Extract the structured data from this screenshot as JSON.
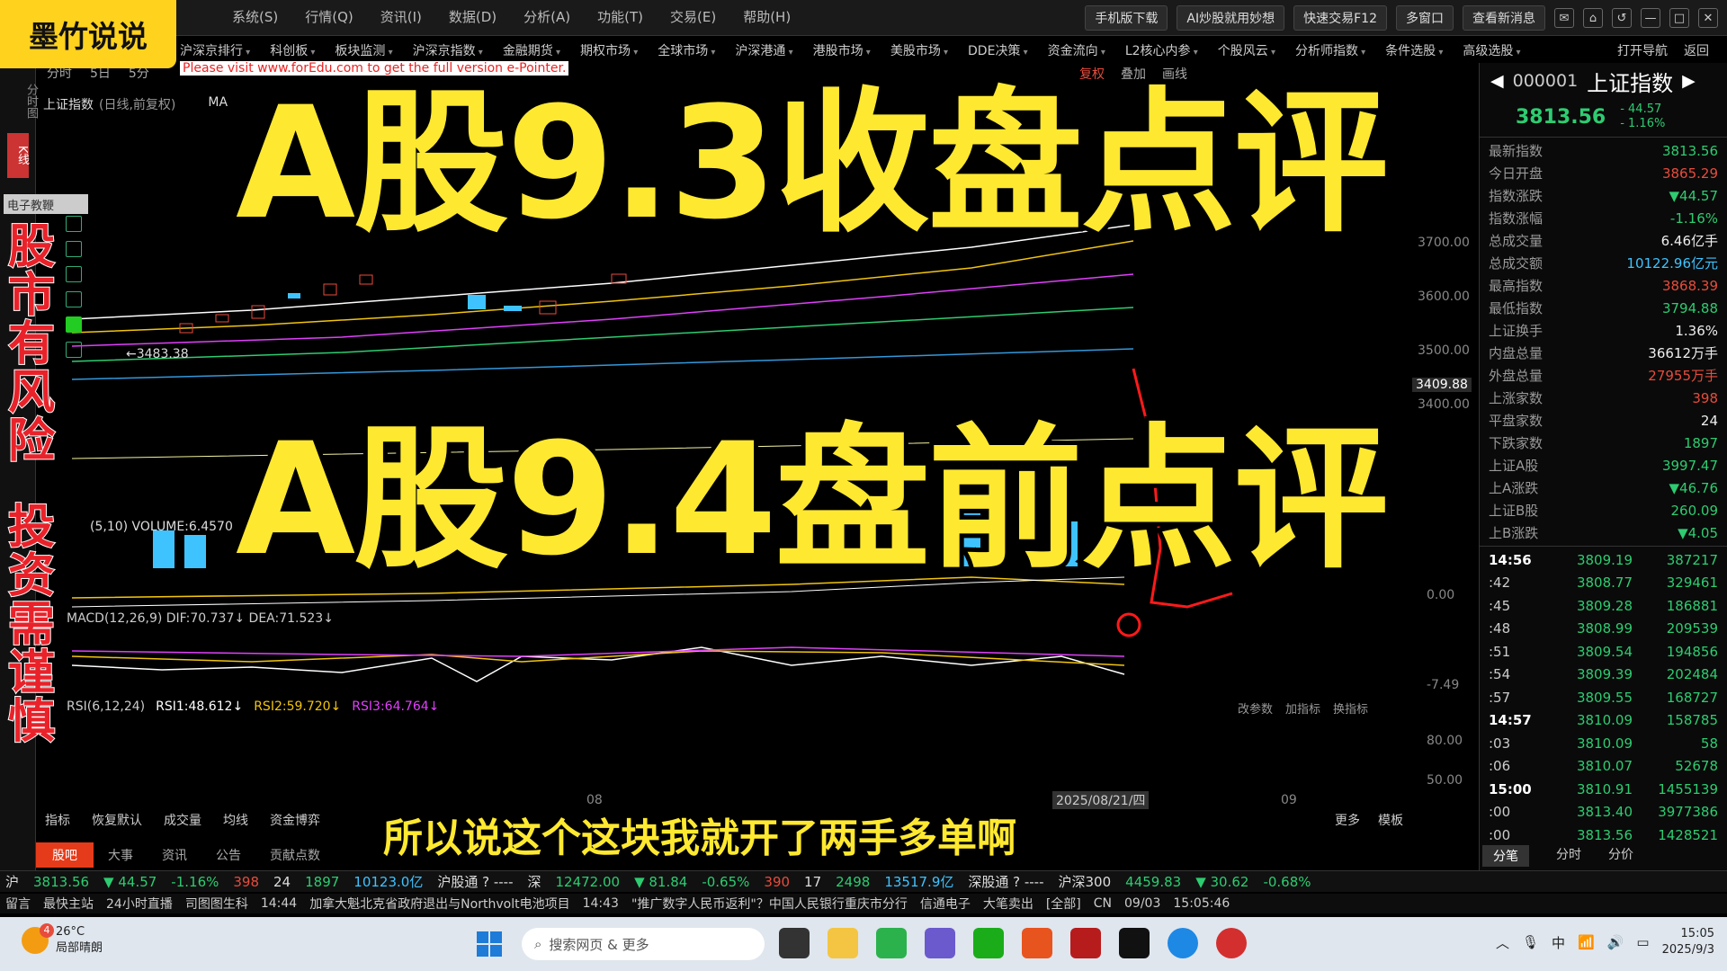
{
  "channel": {
    "name": "墨竹说说"
  },
  "menu": [
    "系统(S)",
    "行情(Q)",
    "资讯(I)",
    "数据(D)",
    "分析(A)",
    "功能(T)",
    "交易(E)",
    "帮助(H)"
  ],
  "top_buttons": {
    "mobile": "手机版下载",
    "ai": "AI炒股就用妙想",
    "quick_trade": "快速交易F12",
    "multi_window": "多窗口",
    "news": "查看新消息"
  },
  "nav": [
    "沪深京排行",
    "科创板",
    "板块监测",
    "沪深京指数",
    "金融期货",
    "期权市场",
    "全球市场",
    "沪深港通",
    "港股市场",
    "美股市场",
    "DDE决策",
    "资金流向",
    "L2核心内参",
    "个股风云",
    "分析师指数",
    "条件选股",
    "高级选股"
  ],
  "nav_right": {
    "open_nav": "打开导航",
    "back": "返回"
  },
  "chart": {
    "toolbar": [
      "分时",
      "5日",
      "5分"
    ],
    "right_tools": [
      "复权",
      "叠加",
      "画线"
    ],
    "title": "上证指数",
    "subtitle": "(日线,前复权)",
    "ma_label": "MA",
    "note": "Please visit www.forEdu.com to get the full version e-Pointer.",
    "low_marker": "←3483.38",
    "price_tag": "3409.88",
    "y_labels": [
      "3700.00",
      "3600.00",
      "3500.00",
      "3400.00"
    ],
    "volume_label": "(5,10)  VOLUME:6.4570",
    "macd_label": "MACD(12,26,9)  DIF:70.737↓  DEA:71.523↓",
    "rsi_label": "RSI(6,12,24)",
    "rsi1": "RSI1:48.612↓",
    "rsi2": "RSI2:59.720↓",
    "rsi3": "RSI3:64.764↓",
    "macd_values": [
      "0.00",
      "-7.49"
    ],
    "rsi_values": [
      "80.00",
      "50.00"
    ],
    "date_label": "2025/08/21/四",
    "x_labels": [
      "08",
      "09"
    ],
    "ind_controls": [
      "改参数",
      "加指标",
      "换指标"
    ],
    "sidebar_tag": "电子教鞭"
  },
  "left_strip": {
    "items": [
      "分时图",
      "K线"
    ]
  },
  "headline": {
    "line1": "A股9.3收盘点评",
    "line2": "A股9.4盘前点评"
  },
  "side_warning": {
    "top": [
      "股",
      "市",
      "有",
      "风",
      "险"
    ],
    "bottom": [
      "投",
      "资",
      "需",
      "谨",
      "慎"
    ]
  },
  "subtitle": "所以说这个这块我就开了两手多单啊",
  "quote": {
    "code": "000001",
    "name": "上证指数",
    "price": "3813.56",
    "change": "- 44.57",
    "change_pct": "- 1.16%",
    "stats": [
      {
        "k": "最新指数",
        "v": "3813.56",
        "c": "green"
      },
      {
        "k": "今日开盘",
        "v": "3865.29",
        "c": "red"
      },
      {
        "k": "指数涨跌",
        "v": "▼44.57",
        "c": "green"
      },
      {
        "k": "指数涨幅",
        "v": "-1.16%",
        "c": "green"
      },
      {
        "k": "总成交量",
        "v": "6.46亿手",
        "c": ""
      },
      {
        "k": "总成交额",
        "v": "10122.96亿元",
        "c": "cyan"
      },
      {
        "k": "最高指数",
        "v": "3868.39",
        "c": "red"
      },
      {
        "k": "最低指数",
        "v": "3794.88",
        "c": "green"
      },
      {
        "k": "上证换手",
        "v": "1.36%",
        "c": ""
      },
      {
        "k": "内盘总量",
        "v": "36612万手",
        "c": ""
      },
      {
        "k": "外盘总量",
        "v": "27955万手",
        "c": "red"
      },
      {
        "k": "上涨家数",
        "v": "398",
        "c": "red"
      },
      {
        "k": "平盘家数",
        "v": "24",
        "c": ""
      },
      {
        "k": "下跌家数",
        "v": "1897",
        "c": "green"
      },
      {
        "k": "上证A股",
        "v": "3997.47",
        "c": "green"
      },
      {
        "k": "上A涨跌",
        "v": "▼46.76",
        "c": "green"
      },
      {
        "k": "上证B股",
        "v": "260.09",
        "c": "green"
      },
      {
        "k": "上B涨跌",
        "v": "▼4.05",
        "c": "green"
      }
    ],
    "ticks": [
      {
        "t": "14:56",
        "p": "3809.19",
        "v": "387217",
        "w": true
      },
      {
        "t": ":42",
        "p": "3808.77",
        "v": "329461",
        "w": false
      },
      {
        "t": ":45",
        "p": "3809.28",
        "v": "186881",
        "w": false
      },
      {
        "t": ":48",
        "p": "3808.99",
        "v": "209539",
        "w": false
      },
      {
        "t": ":51",
        "p": "3809.54",
        "v": "194856",
        "w": false
      },
      {
        "t": ":54",
        "p": "3809.39",
        "v": "202484",
        "w": false
      },
      {
        "t": ":57",
        "p": "3809.55",
        "v": "168727",
        "w": false
      },
      {
        "t": "14:57",
        "p": "3810.09",
        "v": "158785",
        "w": true
      },
      {
        "t": ":03",
        "p": "3810.09",
        "v": "58",
        "w": false
      },
      {
        "t": ":06",
        "p": "3810.07",
        "v": "52678",
        "w": false
      },
      {
        "t": "15:00",
        "p": "3810.91",
        "v": "1455139",
        "w": true
      },
      {
        "t": ":00",
        "p": "3813.40",
        "v": "3977386",
        "w": false
      },
      {
        "t": ":00",
        "p": "3813.56",
        "v": "1428521",
        "w": false
      }
    ],
    "tabs": [
      "分笔",
      "分时",
      "分价"
    ]
  },
  "bottom_tabs": [
    "股吧",
    "大事",
    "资讯",
    "公告",
    "贡献点数"
  ],
  "ind_tabs": [
    "指标",
    "恢复默认",
    "成交量",
    "均线",
    "资金博弈"
  ],
  "ind_tabs_right": [
    "更多",
    "模板"
  ],
  "status": {
    "sh_label": "沪",
    "sh_price": "3813.56",
    "sh_chg": "▼ 44.57",
    "sh_pct": "-1.16%",
    "sh_up": "398",
    "sh_flat": "24",
    "sh_down": "1897",
    "sh_amount": "10123.0亿",
    "hgt": "沪股通 ?  ----",
    "sz_label": "深",
    "sz_price": "12472.00",
    "sz_chg": "▼ 81.84",
    "sz_pct": "-0.65%",
    "sz_up": "390",
    "sz_flat": "17",
    "sz_down": "2498",
    "sz_amount": "13517.9亿",
    "sgt": "深股通 ?  ----",
    "hs300_label": "沪深300",
    "hs300_price": "4459.83",
    "hs300_chg": "▼ 30.62",
    "hs300_pct": "-0.68%"
  },
  "news": {
    "items": [
      "留言",
      "最快主站",
      "24小时直播",
      "司图图生科",
      "14:44",
      "加拿大魁北克省政府退出与Northvolt电池项目",
      "14:43",
      "\"推广数字人民币返利\"？中国人民银行重庆市分行",
      "信通电子",
      "大笔卖出",
      "[全部]",
      "CN",
      "09/03",
      "15:05:46"
    ]
  },
  "taskbar": {
    "temp": "26°C",
    "weather": "局部晴朗",
    "search_placeholder": "搜索网页 & 更多",
    "ime": "中",
    "time": "15:05",
    "date": "2025/9/3"
  },
  "colors": {
    "accent_yellow": "#ffe930",
    "down_green": "#2ecc71",
    "up_red": "#e74c3c",
    "warning_red": "#e9222a"
  }
}
